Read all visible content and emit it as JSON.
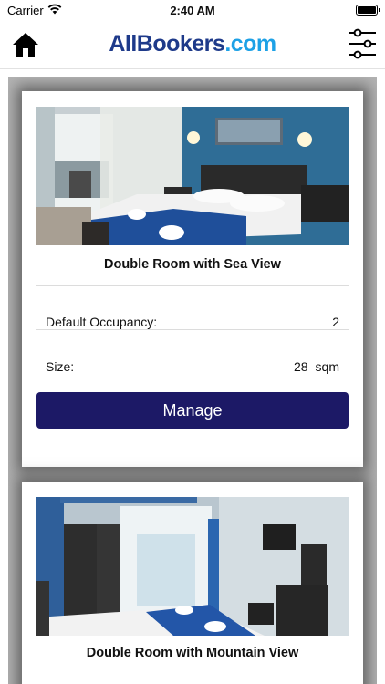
{
  "status_bar": {
    "carrier": "Carrier",
    "time": "2:40 AM"
  },
  "header": {
    "logo_main": "AllBookers",
    "logo_tld": ".com",
    "home_icon": "home-icon",
    "filter_icon": "sliders-icon"
  },
  "rooms": [
    {
      "title": "Double Room with Sea View",
      "occupancy_label": "Default Occupancy:",
      "occupancy_value": "2",
      "size_label": "Size:",
      "size_value": "28",
      "size_unit": "sqm",
      "manage_label": "Manage"
    },
    {
      "title": "Double Room with Mountain View"
    }
  ],
  "colors": {
    "brand_dark": "#1e3a8a",
    "brand_light": "#1da1e6",
    "button": "#1c1966"
  }
}
